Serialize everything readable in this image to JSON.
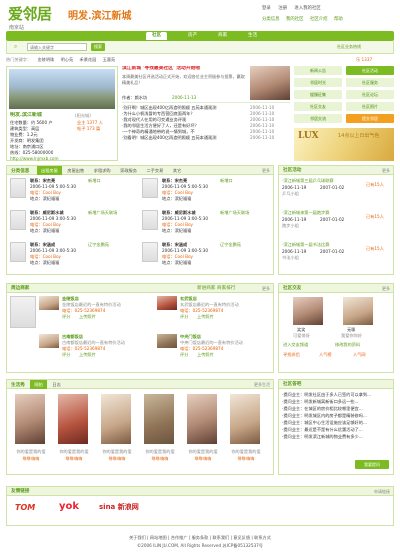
{
  "header": {
    "logo": "爱邻居",
    "logo_sub": "南京站",
    "slogan": "明发.滨江新城",
    "top_links": [
      "登录",
      "注册",
      "进入我的社区"
    ],
    "top_links2": [
      "分类信息",
      "我的社区",
      "社区介绍",
      "帮助"
    ]
  },
  "nav": {
    "items": [
      "社区",
      "房产",
      "商家",
      "生活"
    ],
    "active": "社区"
  },
  "search": {
    "placeholder": "请输入关键字",
    "button": "搜索",
    "city_label": "社区业务热线",
    "right_label": "乐 1337"
  },
  "hot": {
    "items": [
      "热门关键字：",
      "金陵明珠",
      "明心苑",
      "禾景花园",
      "玉蓉苑",
      "社区"
    ]
  },
  "community": {
    "title": "明发.滨江新城",
    "subtitle": "(阳光城)",
    "rating_label": "社区：",
    "fields": [
      "住宅数量：约 5600 户",
      "建筑类型：高层",
      "物业费：1.2元",
      "开发商：明发集团",
      "地址：南京浦口区",
      "热线：025-58000000"
    ],
    "counts": [
      "业主 1377 人",
      "帖子 173 篇"
    ],
    "website": "http://www.lnjmxb.com"
  },
  "featured": {
    "title": "滨江新城 '寻找最美社区' 活动开始啦",
    "desc": "本周最美社区评选活动正式开始，欢迎各位业主积极参与投票，赢取精美礼品！",
    "author": "作者：颜水坊",
    "time": "2006-11-13"
  },
  "news": [
    "·别开啊！城区出现400亿再造明照顺 五苑本通观测",
    "·为什么小帆浅冒的专西营回底面两年？",
    "·我对现代人在用的可交通业务评观",
    "·我的邻居生活方便好了人，还是有好坏？",
    "·一个神奇的精通地带的说一情到城，不",
    "·别看明！城区出现400亿再造明照顺 五苑本通观测"
  ],
  "news_dates": [
    "2006-11-10",
    "2006-11-10",
    "2006-11-10",
    "2006-11-10",
    "2006-11-10",
    "2006-11-10"
  ],
  "side_buttons": [
    "新闻公告",
    "社区活动",
    "邻居时光",
    "社区服务",
    "缓慢征集",
    "社区论坛",
    "社区交友",
    "社区照片",
    "邻居交流",
    "提交邻居"
  ],
  "ad": {
    "lux": "LUX",
    "text": "14点以上日出气色"
  },
  "categories": {
    "title": "分类信息",
    "tabs": [
      "出租房屋",
      "房屋出售",
      "求租求购",
      "家政服务",
      "二手交易",
      "其它"
    ],
    "more": "更多",
    "items": [
      {
        "name": "联系：宋杰亮",
        "tag": "新增口",
        "time": "2006-11-09 5:00-5:30",
        "phone": "电话：Cool Boy",
        "loc": "地点：滨纪福福"
      },
      {
        "name": "联系：宋杰亮",
        "tag": "新增口",
        "time": "2006-11-09 5:00-5:30",
        "phone": "电话：Cool Boy",
        "loc": "地点：滨纪福福"
      },
      {
        "name": "联系：威尼斯水城",
        "tag": "新增广场天联场",
        "time": "2006-11-09 3:00-5:30",
        "phone": "电话：Cool Boy",
        "loc": "地点：滨纪福福"
      },
      {
        "name": "联系：威尼斯水城",
        "tag": "新增广场天联场",
        "time": "2006-11-09 3:00-5:30",
        "phone": "电话：Cool Boy",
        "loc": "地点：滨纪福福"
      },
      {
        "name": "联系：宋涵成",
        "tag": "辽宁金鹏苑",
        "time": "2006-11-09 3:00-5:30",
        "phone": "电话：Cool Boy",
        "loc": "地点：滨纪福福"
      },
      {
        "name": "联系：宋涵成",
        "tag": "辽宁金鹏苑",
        "time": "2006-11-09 3:00-5:30",
        "phone": "电话：Cool Boy",
        "loc": "地点：滨纪福福"
      }
    ]
  },
  "activities": {
    "title": "社区活动",
    "more": "更多",
    "items": [
      {
        "title": "·滨江新城第三届乒乓球联赛",
        "status": "已有15人",
        "time": "2006-11-19",
        "date2": "2007-01-02",
        "org": "乒乓小组"
      },
      {
        "title": "·滨江新城来第一届跑步赛",
        "status": "已有15人",
        "time": "2006-11-19",
        "date2": "2007-01-02",
        "org": "跑步小组"
      },
      {
        "title": "·滨江新城第一届书法比赛",
        "status": "已有15人",
        "time": "2006-11-19",
        "date2": "2007-01-02",
        "org": "书法小组"
      }
    ]
  },
  "shops": {
    "title": "周边商家",
    "more": "更多",
    "links": [
      "新进商家",
      "商家排行",
      "商家名录"
    ],
    "items": [
      {
        "name": "金陵饭店",
        "desc": "金陵饭店最近的一直有特价活动",
        "phone": "电话：025-52369874",
        "actions": [
          "评分",
          "上传照片"
        ]
      },
      {
        "name": "玄武饭店",
        "desc": "玄武饭店最近的一直有特价活动",
        "phone": "电话：025-52369874",
        "actions": [
          "评分",
          "上传照片"
        ]
      },
      {
        "name": "古南都饭店",
        "desc": "古南都饭店最近的一直有特价活动",
        "phone": "电话：025-52369874",
        "actions": [
          "评分",
          "上传照片"
        ]
      },
      {
        "name": "中央门饭店",
        "desc": "中央门饭店最近的一直有特价活动",
        "phone": "电话：025-52369874",
        "actions": [
          "评分",
          "上传照片"
        ]
      }
    ]
  },
  "friends": {
    "title": "社区交友",
    "more": "更多",
    "names": [
      "笑笑",
      "无聊"
    ],
    "captions": [
      "可爱俏伢",
      "我爱你你好"
    ],
    "buttons": [
      "进入交友频道",
      "修改我的资料"
    ],
    "links": [
      "寻找伴侣",
      "人气榜",
      "人气网"
    ]
  },
  "life": {
    "title": "生活秀",
    "tabs": [
      "随拍",
      "日志"
    ],
    "more": "更多生活",
    "photos": [
      {
        "cap": "你的爱是我的爱",
        "name": "咻咻嗨嗨"
      },
      {
        "cap": "你的爱是我的爱",
        "name": "咻咻嗨嗨"
      },
      {
        "cap": "你的爱是我的爱",
        "name": "咻咻嗨嗨"
      },
      {
        "cap": "你的爱是我的爱",
        "name": "咻咻嗨嗨"
      },
      {
        "cap": "你的爱是我的爱",
        "name": "咻咻嗨嗨"
      },
      {
        "cap": "你的爱是我的爱",
        "name": "咻咻嗨嗨"
      }
    ]
  },
  "answers": {
    "title": "社区答吧",
    "items": [
      "·提问业主：明发社区由于多人已签约可以拿到...",
      "·提问业主：明发新城离新街口多远一些...",
      "·提问业主：在城区的房价相比较哪里便宜...",
      "·提问业主：明发城区内的房子都是精装修吗...",
      "·提问业主：城区中心生活设施应该足够好的...",
      "·提问业主：最近是不是有什么优惠活动了...",
      "·提问业主：明发滨江新城的物业费有多少..."
    ],
    "btn": "我要提问"
  },
  "partners": {
    "title": "友情链接",
    "more": "申请链接",
    "items": [
      "TOM",
      "yok",
      "sina 新浪网"
    ]
  },
  "footer": {
    "links": [
      "关于我们",
      "网站地图",
      "合作推广",
      "服务条款",
      "联系我们",
      "意见反馈",
      "联系方式"
    ],
    "copy": "©2006 ILIN JU.COM, All Rights Reserved 苏ICP备05132537号"
  }
}
